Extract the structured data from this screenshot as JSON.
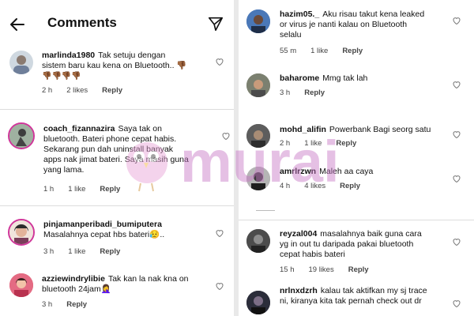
{
  "header": {
    "title": "Comments",
    "back_icon": "back-arrow-icon",
    "filter_icon": "paper-plane-icon"
  },
  "left_comments": [
    {
      "user": "marlinda1980",
      "lines": [
        "Tak setuju dengan",
        "sistem baru kau kena on Bluetooth.. 👎🏾",
        "👎🏾👎🏾👎🏾👎🏾"
      ],
      "time": "2 h",
      "likes": "2 likes",
      "reply": "Reply"
    },
    {
      "user": "coach_fizannazira",
      "lines": [
        "Saya tak on",
        "bluetooth. Bateri phone cepat habis.",
        "Sekarang pun dah uninstall  banyak",
        "apps nak jimat bateri. Saya masih guna",
        "yang lama."
      ],
      "time": "1 h",
      "likes": "1 like",
      "reply": "Reply"
    },
    {
      "user": "pinjamanperibadi_bumiputera",
      "lines": [
        "Masalahnya cepat hbs bateri😥.."
      ],
      "time": "3 h",
      "likes": "1 like",
      "reply": "Reply"
    },
    {
      "user": "azziewindrylibie",
      "lines": [
        "Tak kan la nak kna on",
        "bluetooth 24jam🤦‍♀️"
      ],
      "time": "3 h",
      "likes": "",
      "reply": "Reply"
    }
  ],
  "right_comments": [
    {
      "user": "hazim05._",
      "lines": [
        "Aku risau takut kena leaked",
        "or virus je nanti kalau on Bluetooth",
        "selalu"
      ],
      "time": "55 m",
      "likes": "1 like",
      "reply": "Reply"
    },
    {
      "user": "baharome",
      "lines": [
        "Mmg tak lah"
      ],
      "time": "3 h",
      "likes": "",
      "reply": "Reply"
    },
    {
      "user": "mohd_alifin",
      "lines": [
        "Powerbank Bagi seorg satu"
      ],
      "time": "2 h",
      "likes": "1 like",
      "reply": "Reply"
    },
    {
      "user": "amrlrzwn",
      "lines": [
        "Maleh aa caya"
      ],
      "time": "4 h",
      "likes": "4 likes",
      "reply": "Reply"
    },
    {
      "user": "reyzal004",
      "lines": [
        "masalahnya baik guna cara",
        "yg in out tu daripada pakai bluetooth",
        "cepat habis bateri"
      ],
      "time": "15 h",
      "likes": "19 likes",
      "reply": "Reply"
    },
    {
      "user": "nrlnxdzrh",
      "lines": [
        "kalau tak aktifkan my sj trace",
        "ni, kiranya kita tak pernah check out dr"
      ],
      "time": "",
      "likes": "",
      "reply": ""
    }
  ],
  "watermark": "murai",
  "colors": {
    "ring": "#d0369a",
    "watermark": "#c774c5",
    "bird": "#e7a0d6"
  }
}
